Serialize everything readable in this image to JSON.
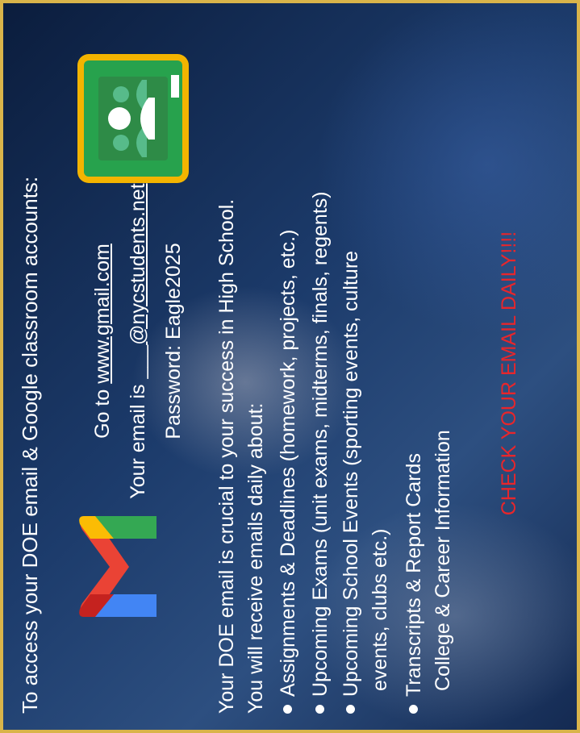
{
  "heading": "To access your DOE email & Google classroom accounts:",
  "instructions": {
    "line1_prefix": "Go to ",
    "line1_link": "www.gmail.com",
    "line2_prefix": "Your email is ___",
    "line2_link": "@nycstudents.net",
    "line3": "Password: Eagle2025"
  },
  "paragraph": {
    "line1": "Your DOE email is crucial to your success in High School.",
    "line2": "You will receive emails daily about:"
  },
  "bullets": [
    "Assignments & Deadlines (homework, projects, etc.)",
    "Upcoming Exams (unit exams, midterms, finals, regents)",
    "Upcoming School Events (sporting events, culture",
    "events, clubs etc.)",
    "Transcripts & Report Cards",
    "College & Career Information"
  ],
  "cta": "CHECK YOUR EMAIL DAILY!!!!",
  "icons": {
    "gmail": "gmail-logo-icon",
    "classroom": "google-classroom-logo-icon"
  },
  "colors": {
    "frame": "#d9b44a",
    "cta": "#e8262b",
    "text": "#ffffff"
  }
}
